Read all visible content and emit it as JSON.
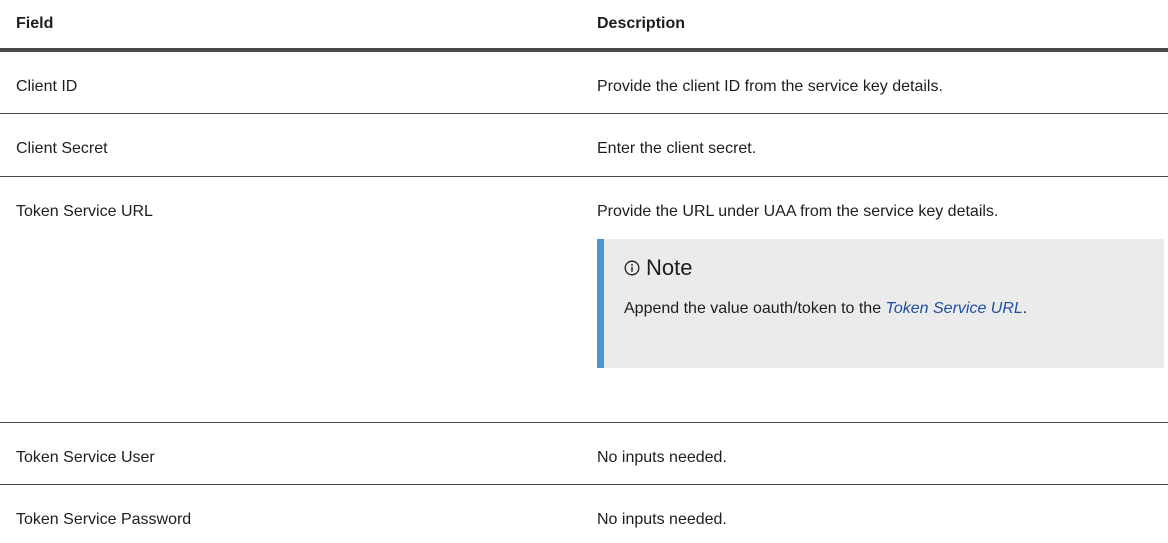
{
  "table": {
    "headers": {
      "field": "Field",
      "description": "Description"
    },
    "rows": [
      {
        "field": "Client ID",
        "description": "Provide the client ID from the service key details."
      },
      {
        "field": "Client Secret",
        "description": "Enter the client secret."
      },
      {
        "field": "Token Service URL",
        "description": "Provide the URL under UAA from the service key details."
      },
      {
        "field": "Token Service User",
        "description": "No inputs needed."
      },
      {
        "field": "Token Service Password",
        "description": "No inputs needed."
      }
    ]
  },
  "note": {
    "icon": "info-icon",
    "title": "Note",
    "text_before": "Append the value oauth/token to the ",
    "link_text": "Token Service URL",
    "text_after": ".",
    "accent_color": "#4a96d2",
    "link_color": "#1f4fa0",
    "background_color": "#ebebeb"
  }
}
